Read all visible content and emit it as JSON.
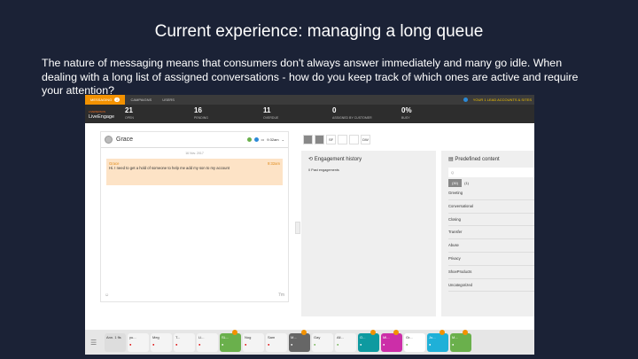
{
  "title": "Current experience: managing a long queue",
  "paragraph": "The nature of messaging means that consumers don't always answer immediately and many go idle. When dealing with a long list of assigned conversations - how do you keep track of which ones are active and require your attention?",
  "topbar": {
    "tabs": [
      "MESSAGING",
      "CAMPAIGNS",
      "USERS"
    ],
    "badge": "2",
    "right": "YOUR 1 LEAD ACCOUNTS & SITES"
  },
  "header": {
    "logo_small": "LIVEPERSON",
    "logo": "LiveEngage",
    "kpis": [
      {
        "value": "21",
        "label": "OPEN"
      },
      {
        "value": "16",
        "label": "PENDING"
      },
      {
        "value": "11",
        "label": "OVERDUE"
      },
      {
        "value": "0",
        "label": "ASSIGNED BY CUSTOMER"
      },
      {
        "value": "0%",
        "label": "BUSY"
      }
    ]
  },
  "chat": {
    "name": "Grace",
    "time": "9:32am",
    "date": "16 Nov. 2017",
    "sender": "Grace",
    "msg_time": "9:32am",
    "message": "Hi. I need to get a hold of someone to help me add my son to my account",
    "foot_time": "7m"
  },
  "tools": [
    "",
    "",
    "SF",
    "",
    "",
    "DW"
  ],
  "engagement": {
    "title": "Engagement history",
    "sub": "0 Past engagements"
  },
  "predefined": {
    "title": "Predefined content",
    "search": "Q",
    "filter_on": "(30)",
    "filter_off": "(1)",
    "categories": [
      "Greeting",
      "Conversational",
      "Closing",
      "Transfer",
      "Abuse",
      "Privacy",
      "ShoeProducts",
      "Uncategorized"
    ]
  },
  "bottom": {
    "first": "Ann. 1 fls",
    "tabs": [
      {
        "name": "yu...",
        "bg": "#f4f4f4"
      },
      {
        "name": "Meg",
        "bg": "#f4f4f4"
      },
      {
        "name": "T...",
        "bg": "#f4f4f4"
      },
      {
        "name": "Ll...",
        "bg": "#f4f4f4"
      },
      {
        "name": "SL...",
        "bg": "#6ab04c",
        "alert": true
      },
      {
        "name": "Nog",
        "bg": "#f4f4f4"
      },
      {
        "name": "Sam",
        "bg": "#f4f4f4"
      },
      {
        "name": "M...",
        "bg": "#666666",
        "alert": true
      },
      {
        "name": "Gay",
        "bg": "#f4f4f4"
      },
      {
        "name": "All...",
        "bg": "#f4f4f4"
      },
      {
        "name": "O...",
        "bg": "#0e9aa0",
        "alert": true
      },
      {
        "name": "Ml...",
        "bg": "#cc2ea8",
        "alert": true
      },
      {
        "name": "Gr...",
        "bg": "#ffffff"
      },
      {
        "name": "Jo...",
        "bg": "#1fb0d8",
        "alert": true
      },
      {
        "name": "M...",
        "bg": "#6ab04c",
        "alert": true
      }
    ]
  }
}
